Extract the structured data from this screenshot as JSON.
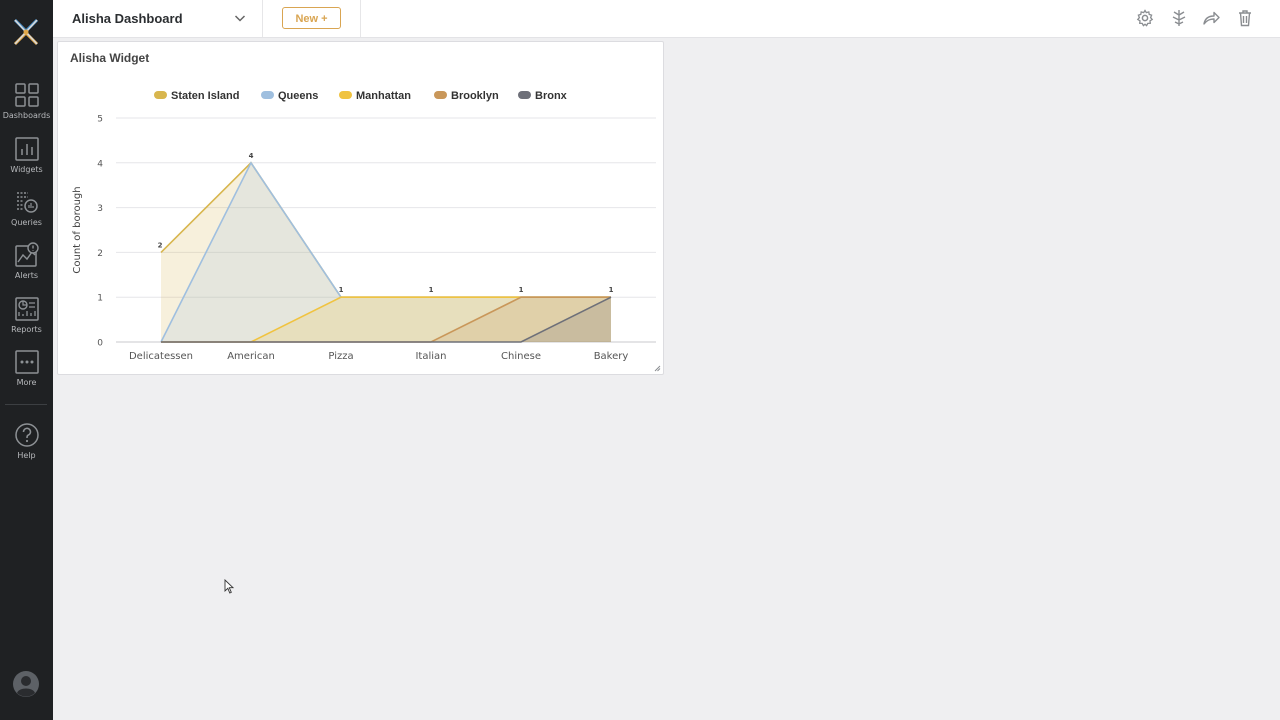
{
  "sidebar": {
    "items": [
      {
        "label": "Dashboards",
        "icon": "dashboards-icon"
      },
      {
        "label": "Widgets",
        "icon": "widgets-icon"
      },
      {
        "label": "Queries",
        "icon": "queries-icon"
      },
      {
        "label": "Alerts",
        "icon": "alerts-icon"
      },
      {
        "label": "Reports",
        "icon": "reports-icon"
      },
      {
        "label": "More",
        "icon": "more-icon"
      },
      {
        "label": "Help",
        "icon": "help-icon"
      }
    ]
  },
  "header": {
    "dashboard_title": "Alisha Dashboard",
    "new_button": "New +",
    "tools": [
      "settings-icon",
      "filter-icon",
      "share-icon",
      "trash-icon"
    ]
  },
  "widget": {
    "title": "Alisha Widget"
  },
  "chart_data": {
    "type": "area",
    "categories": [
      "Delicatessen",
      "American",
      "Pizza",
      "Italian",
      "Chinese",
      "Bakery"
    ],
    "ylabel": "Count of borough",
    "ylim": [
      0,
      5
    ],
    "yticks": [
      0,
      1,
      2,
      3,
      4,
      5
    ],
    "grid": true,
    "legend_position": "top",
    "series": [
      {
        "name": "Staten Island",
        "color": "#d8b64e",
        "values": [
          2,
          4,
          1,
          1,
          1,
          1
        ]
      },
      {
        "name": "Queens",
        "color": "#9fbfdf",
        "values": [
          0,
          4,
          1,
          1,
          1,
          1
        ]
      },
      {
        "name": "Manhattan",
        "color": "#f0c340",
        "values": [
          0,
          0,
          1,
          1,
          1,
          1
        ]
      },
      {
        "name": "Brooklyn",
        "color": "#c9975a",
        "values": [
          0,
          0,
          0,
          0,
          1,
          1
        ]
      },
      {
        "name": "Bronx",
        "color": "#6e7079",
        "values": [
          0,
          0,
          0,
          0,
          0,
          1
        ]
      }
    ],
    "data_labels": [
      2,
      4,
      1,
      1,
      1,
      1
    ]
  }
}
